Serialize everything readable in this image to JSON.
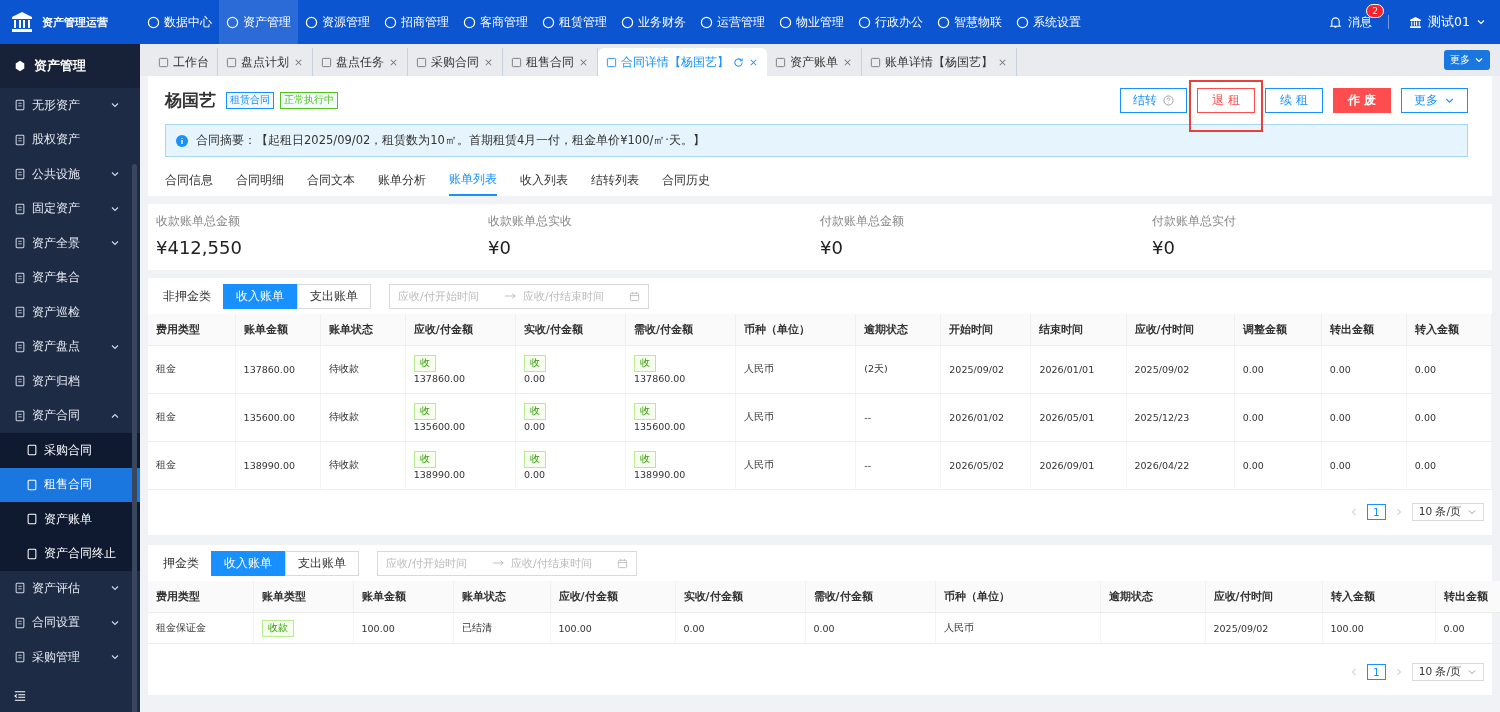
{
  "brand": "资产管理运营",
  "top_nav": [
    {
      "label": "数据中心",
      "selected": false
    },
    {
      "label": "资产管理",
      "selected": true
    },
    {
      "label": "资源管理",
      "selected": false
    },
    {
      "label": "招商管理",
      "selected": false
    },
    {
      "label": "客商管理",
      "selected": false
    },
    {
      "label": "租赁管理",
      "selected": false
    },
    {
      "label": "业务财务",
      "selected": false
    },
    {
      "label": "运营管理",
      "selected": false
    },
    {
      "label": "物业管理",
      "selected": false
    },
    {
      "label": "行政办公",
      "selected": false
    },
    {
      "label": "智慧物联",
      "selected": false
    },
    {
      "label": "系统设置",
      "selected": false
    }
  ],
  "messages": {
    "label": "消息",
    "badge": "2"
  },
  "user": "测试01",
  "sidebar": {
    "title": "资产管理",
    "items": [
      {
        "label": "无形资产",
        "expanded": false
      },
      {
        "label": "股权资产"
      },
      {
        "label": "公共设施",
        "expanded": false
      },
      {
        "label": "固定资产",
        "expanded": false
      },
      {
        "label": "资产全景",
        "expanded": false
      },
      {
        "label": "资产集合"
      },
      {
        "label": "资产巡检"
      },
      {
        "label": "资产盘点",
        "expanded": false
      },
      {
        "label": "资产归档"
      },
      {
        "label": "资产合同",
        "expanded": true,
        "children": [
          {
            "label": "采购合同",
            "selected": false
          },
          {
            "label": "租售合同",
            "selected": true
          },
          {
            "label": "资产账单",
            "selected": false
          },
          {
            "label": "资产合同终止",
            "selected": false
          }
        ]
      },
      {
        "label": "资产评估",
        "expanded": false
      },
      {
        "label": "合同设置",
        "expanded": false
      },
      {
        "label": "采购管理",
        "expanded": false
      }
    ]
  },
  "page_tabs": [
    {
      "label": "工作台",
      "selected": false,
      "closable": false
    },
    {
      "label": "盘点计划",
      "selected": false,
      "closable": true
    },
    {
      "label": "盘点任务",
      "selected": false,
      "closable": true
    },
    {
      "label": "采购合同",
      "selected": false,
      "closable": true
    },
    {
      "label": "租售合同",
      "selected": false,
      "closable": true
    },
    {
      "label": "合同详情【杨国艺】",
      "selected": true,
      "closable": true
    },
    {
      "label": "资产账单",
      "selected": false,
      "closable": true
    },
    {
      "label": "账单详情【杨国艺】",
      "selected": false,
      "closable": true
    }
  ],
  "tabs_more": "更多",
  "header": {
    "title": "杨国艺",
    "tags": [
      {
        "label": "租赁合同",
        "color": "#1890ff"
      },
      {
        "label": "正常执行中",
        "color": "#52c41a"
      }
    ],
    "buttons": [
      {
        "label": "结转",
        "kind": "outline",
        "help": true,
        "dropdown": false,
        "highlighted": false
      },
      {
        "label": "退 租",
        "kind": "outline-danger",
        "help": false,
        "dropdown": false,
        "highlighted": true
      },
      {
        "label": "续 租",
        "kind": "outline",
        "help": false,
        "dropdown": false,
        "highlighted": false
      },
      {
        "label": "作 废",
        "kind": "danger",
        "help": false,
        "dropdown": false,
        "highlighted": false
      },
      {
        "label": "更多",
        "kind": "outline",
        "help": false,
        "dropdown": true,
        "highlighted": false
      }
    ],
    "summary": "合同摘要：【起租日2025/09/02，租赁数为10㎡。首期租赁4月一付，租金单价¥100/㎡·天。】",
    "tabs": [
      {
        "label": "合同信息",
        "selected": false
      },
      {
        "label": "合同明细",
        "selected": false
      },
      {
        "label": "合同文本",
        "selected": false
      },
      {
        "label": "账单分析",
        "selected": false
      },
      {
        "label": "账单列表",
        "selected": true
      },
      {
        "label": "收入列表",
        "selected": false
      },
      {
        "label": "结转列表",
        "selected": false
      },
      {
        "label": "合同历史",
        "selected": false
      }
    ]
  },
  "stats": [
    {
      "label": "收款账单总金额",
      "value": "¥412,550"
    },
    {
      "label": "收款账单总实收",
      "value": "¥0"
    },
    {
      "label": "付款账单总金额",
      "value": "¥0"
    },
    {
      "label": "付款账单总实付",
      "value": "¥0"
    }
  ],
  "tables": [
    {
      "title": "非押金类",
      "toggle": [
        {
          "label": "收入账单",
          "selected": true
        },
        {
          "label": "支出账单",
          "selected": false
        }
      ],
      "date_start": {
        "placeholder": "应收/付开始时间"
      },
      "date_end": {
        "placeholder": "应收/付结束时间"
      },
      "columns": [
        "费用类型",
        "账单金额",
        "账单状态",
        "应收/付金额",
        "实收/付金额",
        "需收/付金额",
        "币种（单位）",
        "逾期状态",
        "开始时间",
        "结束时间",
        "应收/付时间",
        "调整金额",
        "转出金额",
        "转入金额"
      ],
      "rows": [
        [
          "租金",
          "137860.00",
          "待收款",
          {
            "tag": "收",
            "value": "137860.00"
          },
          {
            "tag": "收",
            "value": "0.00"
          },
          {
            "tag": "收",
            "value": "137860.00"
          },
          "人民币",
          "(2天)",
          "2025/09/02",
          "2026/01/01",
          "2025/09/02",
          "0.00",
          "0.00",
          "0.00"
        ],
        [
          "租金",
          "135600.00",
          "待收款",
          {
            "tag": "收",
            "value": "135600.00"
          },
          {
            "tag": "收",
            "value": "0.00"
          },
          {
            "tag": "收",
            "value": "135600.00"
          },
          "人民币",
          "--",
          "2026/01/02",
          "2026/05/01",
          "2025/12/23",
          "0.00",
          "0.00",
          "0.00"
        ],
        [
          "租金",
          "138990.00",
          "待收款",
          {
            "tag": "收",
            "value": "138990.00"
          },
          {
            "tag": "收",
            "value": "0.00"
          },
          {
            "tag": "收",
            "value": "138990.00"
          },
          "人民币",
          "--",
          "2026/05/02",
          "2026/09/01",
          "2026/04/22",
          "0.00",
          "0.00",
          "0.00"
        ]
      ],
      "page": "1",
      "page_size": "10 条/页"
    },
    {
      "title": "押金类",
      "toggle": [
        {
          "label": "收入账单",
          "selected": true
        },
        {
          "label": "支出账单",
          "selected": false
        }
      ],
      "date_start": {
        "placeholder": "应收/付开始时间"
      },
      "date_end": {
        "placeholder": "应收/付结束时间"
      },
      "columns": [
        "费用类型",
        "账单类型",
        "账单金额",
        "账单状态",
        "应收/付金额",
        "实收/付金额",
        "需收/付金额",
        "币种（单位）",
        "逾期状态",
        "应收/付时间",
        "转入金额",
        "转出金额"
      ],
      "rows": [
        [
          "租金保证金",
          {
            "tag": "收款"
          },
          "100.00",
          "已结清",
          "100.00",
          "0.00",
          "0.00",
          "人民币",
          "",
          "2025/09/02",
          "100.00",
          "0.00"
        ]
      ],
      "page": "1",
      "page_size": "10 条/页"
    }
  ]
}
